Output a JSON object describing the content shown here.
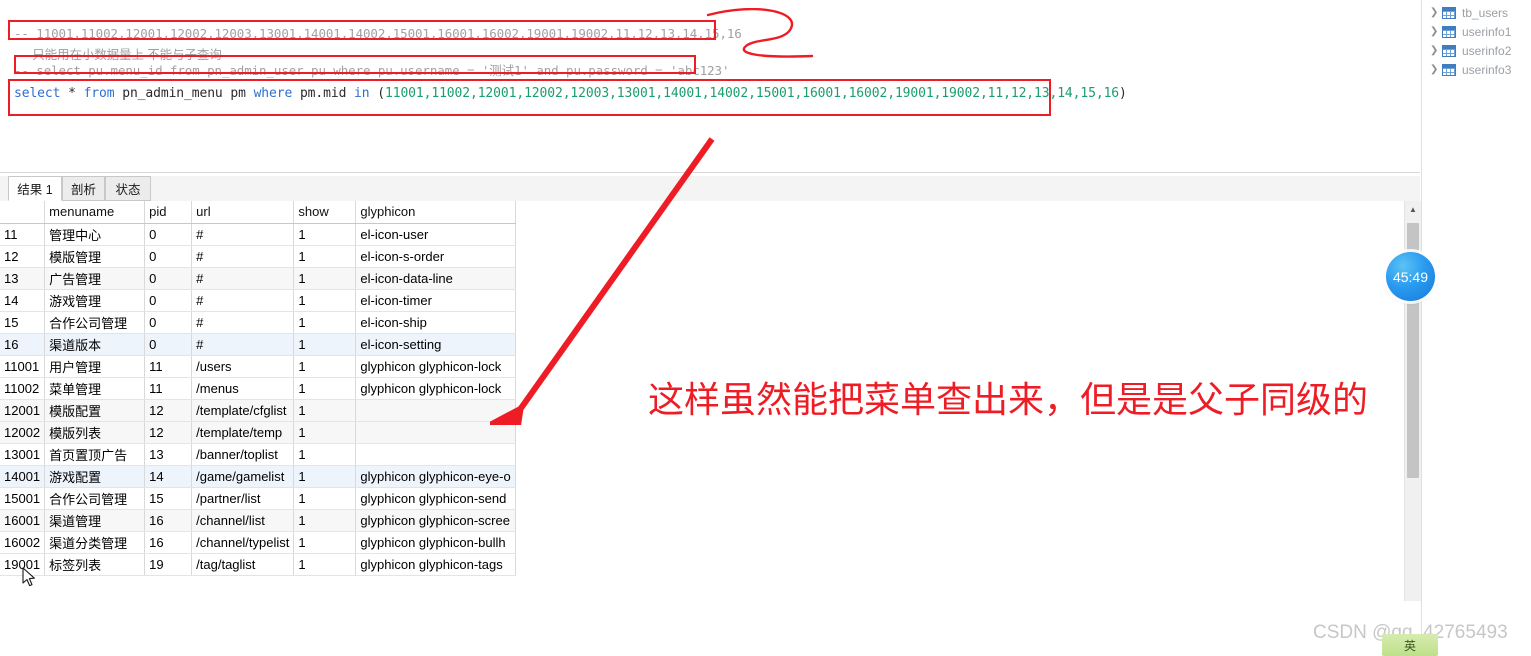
{
  "editor": {
    "comment_ids_prefix": "-- ",
    "comment_ids": "11001,11002,12001,12002,12003,13001,14001,14002,15001,16001,16002,19001,19002,11,12,13,14,15,16",
    "comment_note": "--   只能用在小数据量上 不能与子查询",
    "comment_sql": "-- select pu.menu_id from pn_admin_user pu where pu.username = '测试1' and pu.password = 'abc123'",
    "query": {
      "kw_select": "select",
      "star": " * ",
      "kw_from": "from",
      "table": " pn_admin_menu pm ",
      "kw_where": "where",
      "column": " pm.mid ",
      "kw_in": "in",
      "open_paren": " (",
      "in_list": "11001,11002,12001,12002,12003,13001,14001,14002,15001,16001,16002,19001,19002,11,12,13,14,15,16",
      "close_paren": ")"
    },
    "comment_sql_parts": {
      "lead": "-- select pu.menu_id from pn_admin_user pu where pu.username = ",
      "str1": "'测试1'",
      "mid": " and pu.password = ",
      "str2": "'abc123'"
    }
  },
  "sidebar": {
    "items": [
      {
        "label": "tb_users",
        "chevron": "chevron-right",
        "icon": "table-icon"
      },
      {
        "label": "userinfo1",
        "chevron": "chevron-right",
        "icon": "table-icon"
      },
      {
        "label": "userinfo2",
        "chevron": "chevron-right",
        "icon": "table-icon"
      },
      {
        "label": "userinfo3",
        "chevron": "chevron-right",
        "icon": "table-icon"
      }
    ]
  },
  "tabs": [
    {
      "label": "结果 1",
      "active": true
    },
    {
      "label": "剖析",
      "active": false
    },
    {
      "label": "状态",
      "active": false
    }
  ],
  "grid": {
    "columns": [
      "",
      "menuname",
      "pid",
      "url",
      "show",
      "glyphicon"
    ],
    "rows": [
      {
        "mid": "11",
        "menuname": "管理中心",
        "pid": "0",
        "url": "#",
        "show": "1",
        "glyphicon": "el-icon-user"
      },
      {
        "mid": "12",
        "menuname": "模版管理",
        "pid": "0",
        "url": "#",
        "show": "1",
        "glyphicon": "el-icon-s-order"
      },
      {
        "mid": "13",
        "menuname": "广告管理",
        "pid": "0",
        "url": "#",
        "show": "1",
        "glyphicon": "el-icon-data-line"
      },
      {
        "mid": "14",
        "menuname": "游戏管理",
        "pid": "0",
        "url": "#",
        "show": "1",
        "glyphicon": "el-icon-timer"
      },
      {
        "mid": "15",
        "menuname": "合作公司管理",
        "pid": "0",
        "url": "#",
        "show": "1",
        "glyphicon": "el-icon-ship"
      },
      {
        "mid": "16",
        "menuname": "渠道版本",
        "pid": "0",
        "url": "#",
        "show": "1",
        "glyphicon": "el-icon-setting"
      },
      {
        "mid": "11001",
        "menuname": "用户管理",
        "pid": "11",
        "url": "/users",
        "show": "1",
        "glyphicon": "glyphicon glyphicon-lock"
      },
      {
        "mid": "11002",
        "menuname": "菜单管理",
        "pid": "11",
        "url": "/menus",
        "show": "1",
        "glyphicon": "glyphicon glyphicon-lock"
      },
      {
        "mid": "12001",
        "menuname": "模版配置",
        "pid": "12",
        "url": "/template/cfglist",
        "show": "1",
        "glyphicon": ""
      },
      {
        "mid": "12002",
        "menuname": "模版列表",
        "pid": "12",
        "url": "/template/temp",
        "show": "1",
        "glyphicon": ""
      },
      {
        "mid": "13001",
        "menuname": "首页置顶广告",
        "pid": "13",
        "url": "/banner/toplist",
        "show": "1",
        "glyphicon": ""
      },
      {
        "mid": "14001",
        "menuname": "游戏配置",
        "pid": "14",
        "url": "/game/gamelist",
        "show": "1",
        "glyphicon": "glyphicon glyphicon-eye-o"
      },
      {
        "mid": "15001",
        "menuname": "合作公司管理",
        "pid": "15",
        "url": "/partner/list",
        "show": "1",
        "glyphicon": "glyphicon glyphicon-send"
      },
      {
        "mid": "16001",
        "menuname": "渠道管理",
        "pid": "16",
        "url": "/channel/list",
        "show": "1",
        "glyphicon": "glyphicon glyphicon-scree"
      },
      {
        "mid": "16002",
        "menuname": "渠道分类管理",
        "pid": "16",
        "url": "/channel/typelist",
        "show": "1",
        "glyphicon": "glyphicon glyphicon-bullh"
      },
      {
        "mid": "19001",
        "menuname": "标签列表",
        "pid": "19",
        "url": "/tag/taglist",
        "show": "1",
        "glyphicon": "glyphicon glyphicon-tags"
      }
    ]
  },
  "annotation": {
    "text": "这样虽然能把菜单查出来，但是是父子同级的",
    "color": "#ee1c25"
  },
  "timer": {
    "value": "45:49"
  },
  "watermark": {
    "text": "CSDN @qq_42765493",
    "ime_label": "英"
  }
}
